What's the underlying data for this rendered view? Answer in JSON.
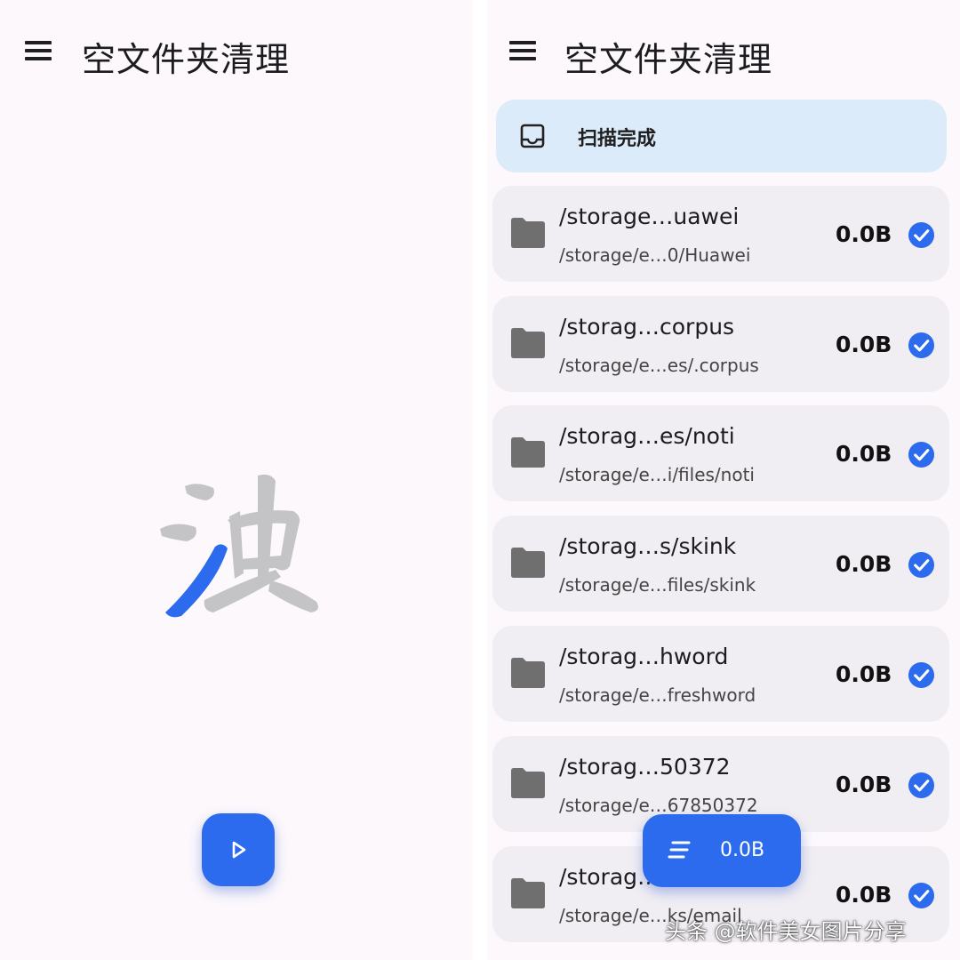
{
  "left_screen": {
    "title": "空文件夹清理",
    "icons": {
      "menu": "hamburger-icon",
      "logo": "brand-logo",
      "fab": "play-icon"
    },
    "colors": {
      "accent": "#2c6bed",
      "logo_gray": "#c4c4c6"
    }
  },
  "right_screen": {
    "title": "空文件夹清理",
    "banner": {
      "text": "扫描完成",
      "icon": "tray-icon"
    },
    "folders": [
      {
        "name": "/storage…uawei",
        "path": "/storage/e…0/Huawei",
        "size": "0.0B",
        "checked": true
      },
      {
        "name": "/storag…corpus",
        "path": "/storage/e…es/.corpus",
        "size": "0.0B",
        "checked": true
      },
      {
        "name": "/storag…es/noti",
        "path": "/storage/e…i/files/noti",
        "size": "0.0B",
        "checked": true
      },
      {
        "name": "/storag…s/skink",
        "path": "/storage/e…files/skink",
        "size": "0.0B",
        "checked": true
      },
      {
        "name": "/storag…hword",
        "path": "/storage/e…freshword",
        "size": "0.0B",
        "checked": true
      },
      {
        "name": "/storag…50372",
        "path": "/storage/e…67850372",
        "size": "0.0B",
        "checked": true
      },
      {
        "name": "/storag…",
        "path": "/storage/e…ks/email",
        "size": "0.0B",
        "checked": true
      }
    ],
    "fab": {
      "label": "0.0B",
      "icon": "sort-icon"
    },
    "colors": {
      "accent": "#2c6bed",
      "banner_bg": "#dcebfa",
      "row_bg": "#f1eef3"
    }
  },
  "watermark": "头条 @软件美女图片分享"
}
